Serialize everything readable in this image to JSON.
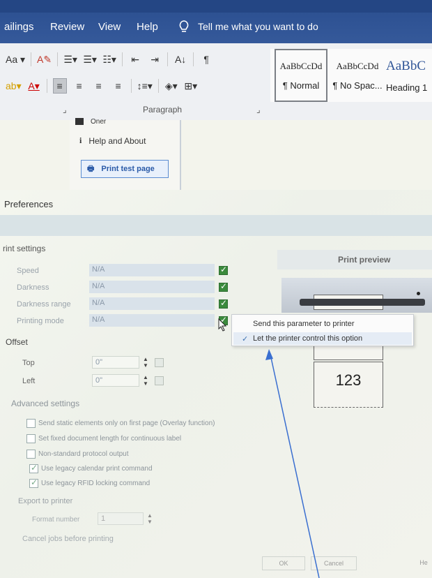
{
  "ribbon": {
    "tabs": [
      "ailings",
      "Review",
      "View",
      "Help"
    ],
    "tell_me": "Tell me what you want to do",
    "font_size_label": "Aa",
    "paragraph_group_label": "Paragraph",
    "sort_icon_text": "A↓",
    "pilcrow": "¶",
    "styles": [
      {
        "sample": "AaBbCcDd",
        "name": "¶ Normal"
      },
      {
        "sample": "AaBbCcDd",
        "name": "¶ No Spac..."
      },
      {
        "sample": "AaBbC",
        "name": "Heading 1"
      }
    ]
  },
  "side_menu": {
    "partial_item": "Oner",
    "help_about": "Help and About",
    "print_test_page": "Print test page"
  },
  "dialog": {
    "title": "Preferences",
    "print_settings_label": "rint settings",
    "fields": [
      {
        "label": "Speed",
        "value": "N/A"
      },
      {
        "label": "Darkness",
        "value": "N/A"
      },
      {
        "label": "Darkness range",
        "value": "N/A"
      },
      {
        "label": "Printing mode",
        "value": "N/A"
      }
    ],
    "offset_label": "Offset",
    "offset_fields": [
      {
        "label": "Top",
        "value": "0\""
      },
      {
        "label": "Left",
        "value": "0\""
      }
    ],
    "advanced_label": "Advanced settings",
    "advanced_options": [
      {
        "label": "Send static elements only on first page (Overlay function)",
        "checked": false
      },
      {
        "label": "Set fixed document length for continuous label",
        "checked": false
      },
      {
        "label": "Non-standard protocol output",
        "checked": false
      },
      {
        "label": "Use legacy calendar print command",
        "checked": true
      },
      {
        "label": "Use legacy RFID locking command",
        "checked": true
      }
    ],
    "export_label": "Export to printer",
    "format_number_label": "Format number",
    "format_number_value": "1",
    "cancel_jobs_label": "Cancel jobs before printing",
    "ok_label": "OK",
    "cancel_label": "Cancel",
    "help_label": "He"
  },
  "popup": {
    "items": [
      {
        "label": "Send this parameter to printer",
        "checked": false
      },
      {
        "label": "Let the printer control this option",
        "checked": true
      }
    ]
  },
  "preview": {
    "title": "Print preview",
    "label_text": "123"
  },
  "colors": {
    "ribbon_blue": "#2a4e8f",
    "check_green": "#3b8a3d",
    "arrow_blue": "#3a6fd0"
  }
}
